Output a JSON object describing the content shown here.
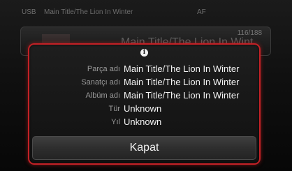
{
  "status_bar": {
    "source": "USB",
    "title": "Main Title/The Lion In Winter",
    "band": "AF"
  },
  "background": {
    "track_counter": "116/188",
    "big_title": "Main Title/The Lion In Wint"
  },
  "popup": {
    "icon": "info-icon",
    "icon_glyph": "i",
    "rows": [
      {
        "label": "Parça adı",
        "value": "Main Title/The Lion In Winter"
      },
      {
        "label": "Sanatçı adı",
        "value": "Main Title/The Lion In Winter"
      },
      {
        "label": "Albüm adı",
        "value": "Main Title/The Lion In Winter"
      },
      {
        "label": "Tür",
        "value": "Unknown"
      },
      {
        "label": "Yıl",
        "value": "Unknown"
      }
    ],
    "close_label": "Kapat"
  },
  "colors": {
    "accent_border": "#c42126",
    "text_primary": "#f4f4f4",
    "text_label": "#9a9a9a"
  }
}
